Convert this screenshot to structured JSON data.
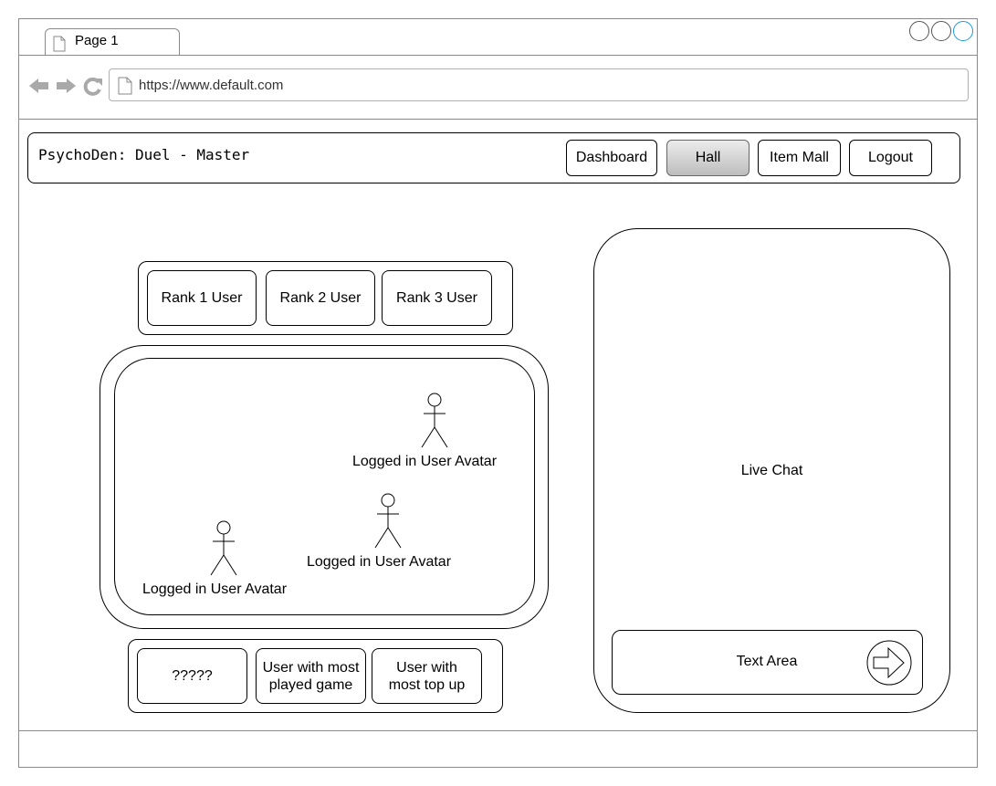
{
  "browser": {
    "tab_title": "Page 1",
    "url": "https://www.default.com"
  },
  "header": {
    "app_title": "PsychoDen: Duel - Master",
    "nav": [
      {
        "label": "Dashboard",
        "active": false
      },
      {
        "label": "Hall",
        "active": true
      },
      {
        "label": "Item Mall",
        "active": false
      },
      {
        "label": "Logout",
        "active": false
      }
    ]
  },
  "ranking": {
    "items": [
      "Rank 1 User",
      "Rank 2 User",
      "Rank 3 User"
    ]
  },
  "hall": {
    "avatars": [
      {
        "label": "Logged in User Avatar"
      },
      {
        "label": "Logged in User Avatar"
      },
      {
        "label": "Logged in User Avatar"
      }
    ]
  },
  "stats": {
    "items": [
      "?????",
      "User with most played game",
      "User with most top up"
    ]
  },
  "chat": {
    "title": "Live Chat",
    "text_area_label": "Text Area",
    "send_icon": "arrow-right-icon"
  },
  "icons": {
    "back": "arrow-left-icon",
    "forward": "arrow-right-icon",
    "reload": "reload-icon",
    "page": "page-icon",
    "person": "stick-figure-icon"
  }
}
